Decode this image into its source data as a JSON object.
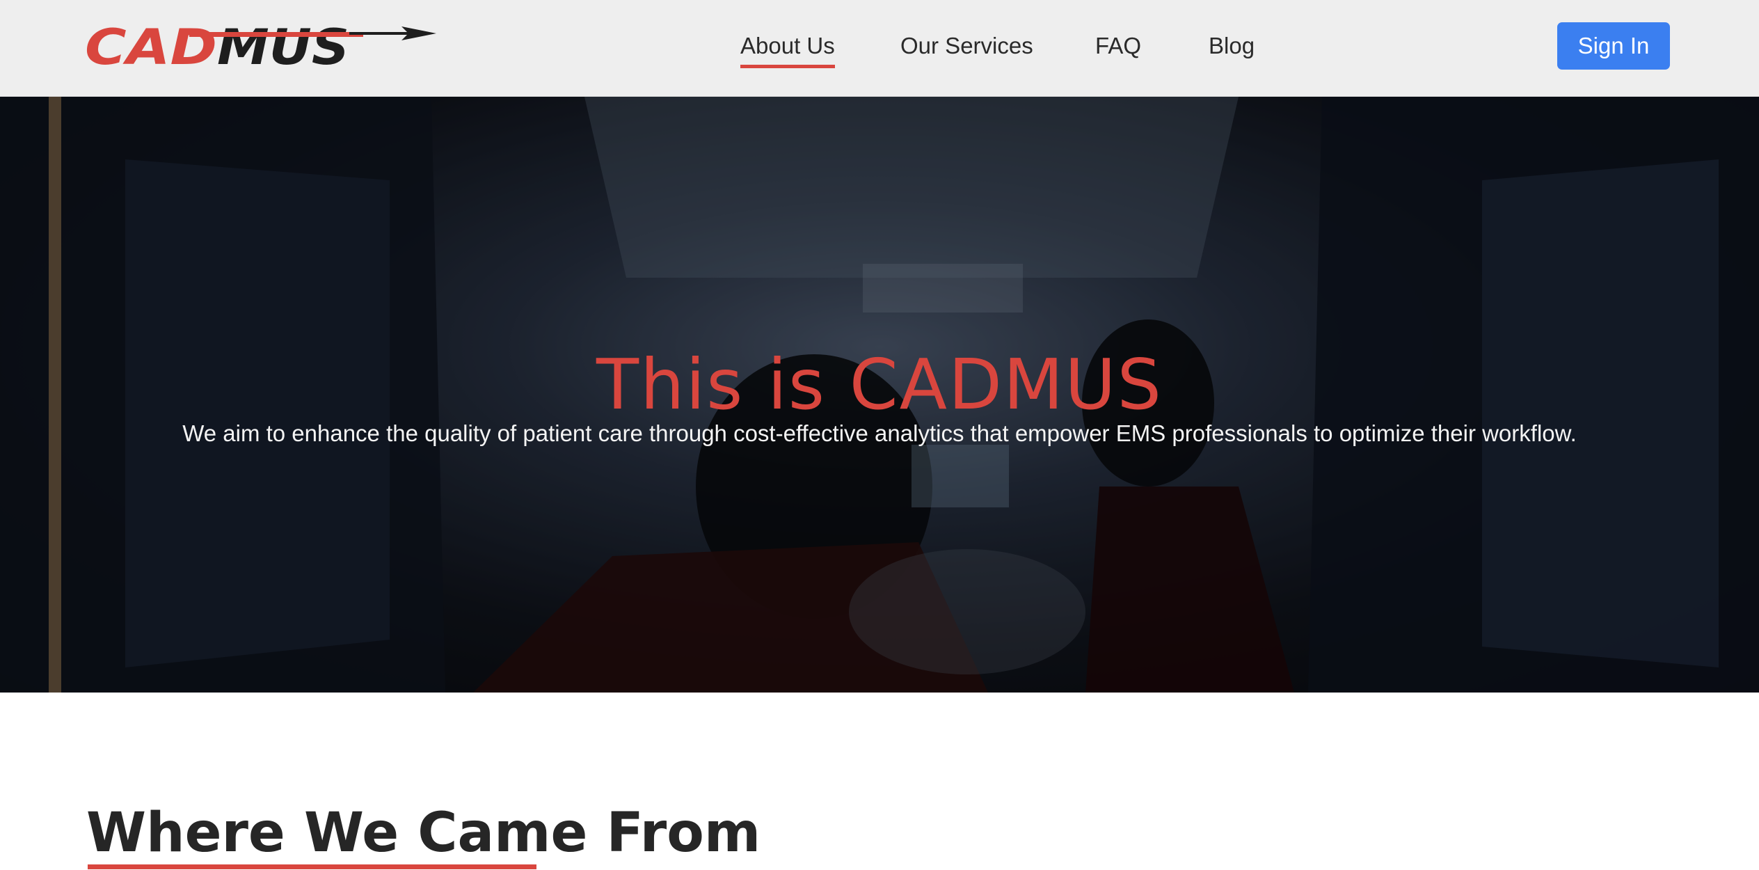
{
  "header": {
    "logo_text": "CADMUS",
    "nav": [
      {
        "label": "About Us",
        "active": true
      },
      {
        "label": "Our Services",
        "active": false
      },
      {
        "label": "FAQ",
        "active": false
      },
      {
        "label": "Blog",
        "active": false
      }
    ],
    "signin_label": "Sign In"
  },
  "hero": {
    "title": "This is CADMUS",
    "subtitle": "We aim to enhance the quality of patient care through cost-effective analytics that empower EMS professionals to optimize their workflow.",
    "background_image": "ambulance-interior-photo"
  },
  "section": {
    "title": "Where We Came From"
  },
  "colors": {
    "accent": "#d9463e",
    "button": "#3b7ff0",
    "header_bg": "#eeeeee"
  }
}
